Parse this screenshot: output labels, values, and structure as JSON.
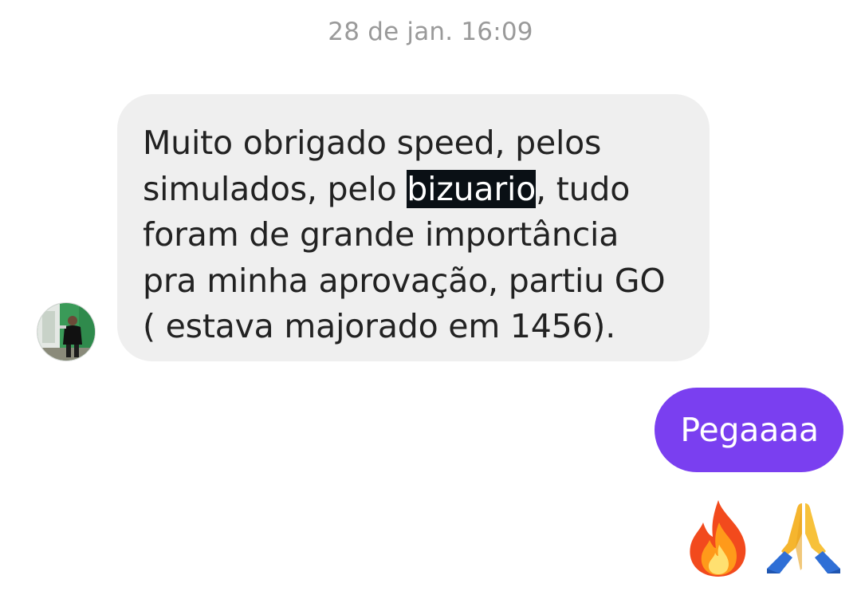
{
  "thread": {
    "timestamp": "28 de jan. 16:09"
  },
  "incoming_message": {
    "lines": [
      {
        "text": "Muito obrigado speed, pelos"
      },
      {
        "before": "simulados, pelo ",
        "highlight": "bizuario",
        "after": ", tudo"
      },
      {
        "text": "foram de grande importância"
      },
      {
        "text": "pra minha aprovação, partiu GO"
      },
      {
        "text": "( estava majorado em 1456)."
      }
    ]
  },
  "outgoing_message": {
    "text": "Pegaaaa"
  },
  "reactions": [
    "fire-emoji",
    "folded-hands-emoji"
  ],
  "colors": {
    "incoming_bubble": "#efefef",
    "outgoing_bubble": "#7a3ff0",
    "timestamp": "#9a9a9a",
    "text_highlight": "#0a1015"
  }
}
